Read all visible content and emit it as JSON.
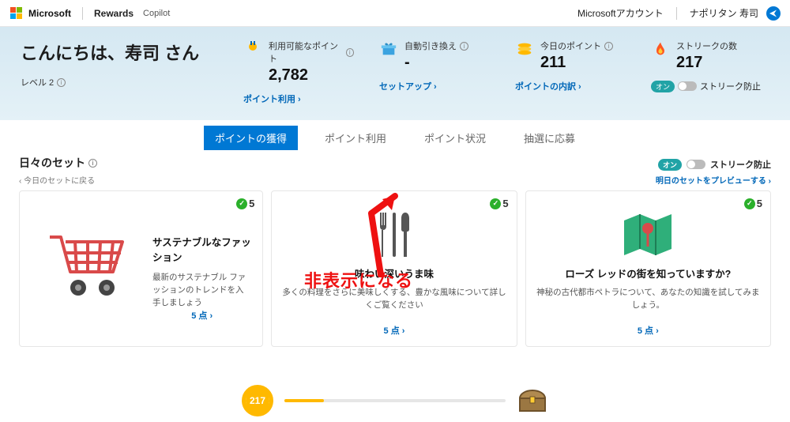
{
  "topbar": {
    "brand": "Microsoft",
    "rewards": "Rewards",
    "copilot": "Copilot",
    "account": "Microsoftアカウント",
    "user": "ナポリタン 寿司"
  },
  "hero": {
    "greeting": "こんにちは、寿司 さん",
    "level": "レベル 2",
    "stats": {
      "points": {
        "label": "利用可能なポイント",
        "value": "2,782",
        "link": "ポイント利用"
      },
      "auto": {
        "label": "自動引き換え",
        "value": "-",
        "link": "セットアップ"
      },
      "today": {
        "label": "今日のポイント",
        "value": "211",
        "link": "ポイントの内訳"
      },
      "streak": {
        "label": "ストリークの数",
        "value": "217",
        "toggle_pill": "オン",
        "toggle_label": "ストリーク防止"
      }
    }
  },
  "tabs": {
    "earn": "ポイントの獲得",
    "redeem": "ポイント利用",
    "status": "ポイント状況",
    "sweep": "抽選に応募"
  },
  "daily": {
    "title": "日々のセット",
    "back": "‹ 今日のセットに戻る",
    "preview": "明日のセットをプレビューする",
    "toggle_pill": "オン",
    "toggle_label": "ストリーク防止",
    "cards": [
      {
        "pts": "5",
        "title": "サステナブルなファッション",
        "desc": "最新のサステナブル ファッションのトレンドを入手しましょう",
        "foot": "5 点"
      },
      {
        "pts": "5",
        "title": "味わい深いうま味",
        "desc": "多くの料理をさらに美味しくする、豊かな風味について詳しくご覧ください",
        "foot": "5 点"
      },
      {
        "pts": "5",
        "title": "ローズ レッドの街を知っていますか?",
        "desc": "神秘の古代都市ペトラについて、あなたの知識を試してみましょう。",
        "foot": "5 点"
      }
    ]
  },
  "annotation": "非表示になる",
  "progress": {
    "value": "217"
  }
}
